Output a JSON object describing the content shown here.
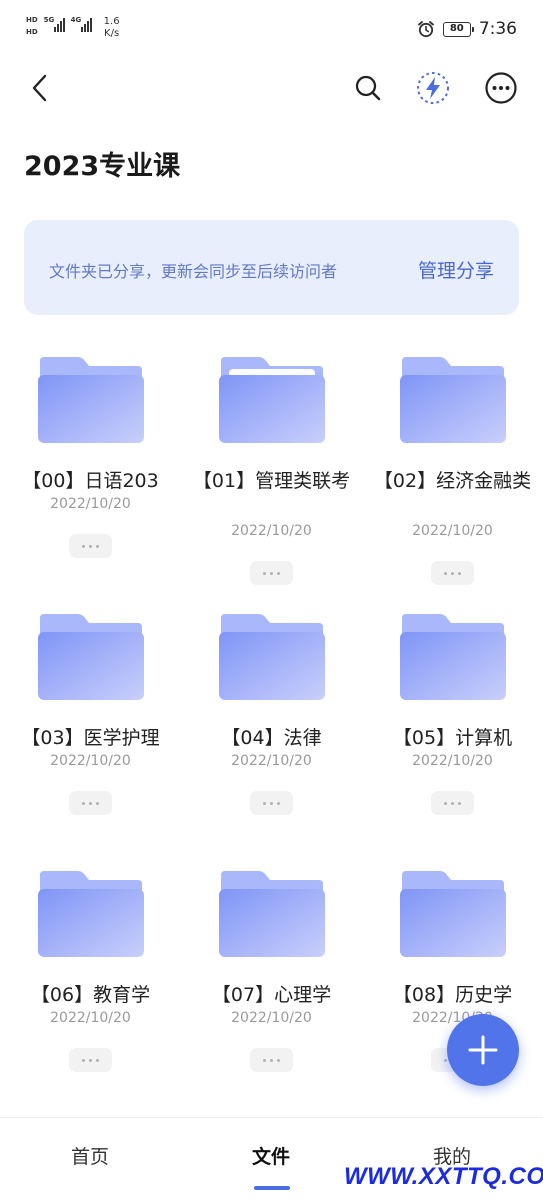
{
  "status_bar": {
    "sim1": "HD",
    "sim2": "HD",
    "net1": "5G",
    "net2": "4G",
    "speed_value": "1.6",
    "speed_unit": "K/s",
    "battery": "80",
    "time": "7:36"
  },
  "page": {
    "title": "2023专业课"
  },
  "share_banner": {
    "text": "文件夹已分享，更新会同步至后续访问者",
    "action": "管理分享"
  },
  "folders": [
    {
      "name": "【00】日语203",
      "date": "2022/10/20"
    },
    {
      "name": "【01】管理类联考",
      "date": "2022/10/20"
    },
    {
      "name": "【02】经济金融类",
      "date": "2022/10/20"
    },
    {
      "name": "【03】医学护理",
      "date": "2022/10/20"
    },
    {
      "name": "【04】法律",
      "date": "2022/10/20"
    },
    {
      "name": "【05】计算机",
      "date": "2022/10/20"
    },
    {
      "name": "【06】教育学",
      "date": "2022/10/20"
    },
    {
      "name": "【07】心理学",
      "date": "2022/10/20"
    },
    {
      "name": "【08】历史学",
      "date": "2022/10/20"
    }
  ],
  "bottom_nav": {
    "home": "首页",
    "files": "文件",
    "mine": "我的"
  },
  "watermark": "WWW.XXTTQ.COM",
  "colors": {
    "accent": "#4a6ce0",
    "banner_bg": "#e9eefd",
    "banner_text": "#6279c9",
    "folder_light": "#a9b8fb",
    "folder_dark": "#7f95f6"
  }
}
